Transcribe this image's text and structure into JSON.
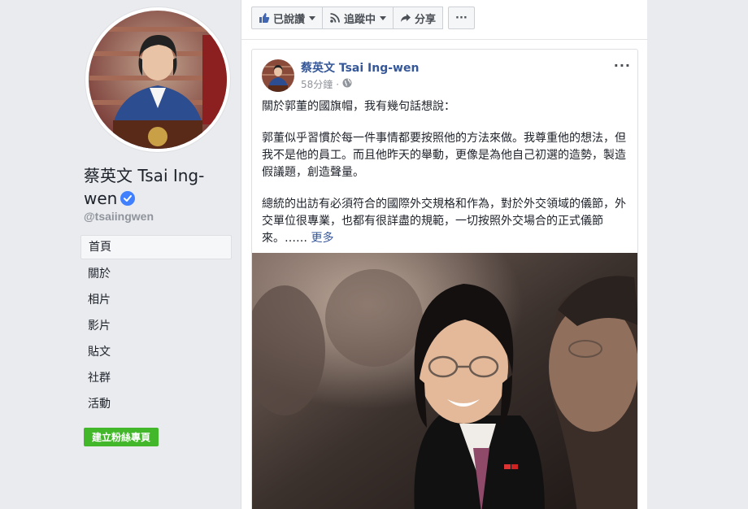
{
  "profile": {
    "name": "蔡英文 Tsai Ing-wen",
    "handle": "@tsaiingwen",
    "verified": true
  },
  "nav": {
    "items": [
      "首頁",
      "關於",
      "相片",
      "影片",
      "貼文",
      "社群",
      "活動"
    ],
    "active_index": 0
  },
  "create_page_button": "建立粉絲專頁",
  "actions": {
    "liked": "已說讚",
    "following": "追蹤中",
    "share": "分享",
    "more": "···"
  },
  "post": {
    "author": "蔡英文 Tsai Ing-wen",
    "time": "58分鐘",
    "paragraphs": [
      "關於郭董的國旗帽，我有幾句話想說：",
      "郭董似乎習慣於每一件事情都要按照他的方法來做。我尊重他的想法，但我不是他的員工。而且他昨天的舉動，更像是為他自己初選的造勢，製造假議題，創造聲量。",
      "總統的出訪有必須符合的國際外交規格和作為，對於外交領域的儀節，外交單位很專業，也都有很詳盡的規範，一切按照外交場合的正式儀節來。……"
    ],
    "see_more": "更多",
    "more_icon": "···"
  },
  "colors": {
    "link": "#365899",
    "green": "#42b72a",
    "verified": "#4080ff"
  }
}
